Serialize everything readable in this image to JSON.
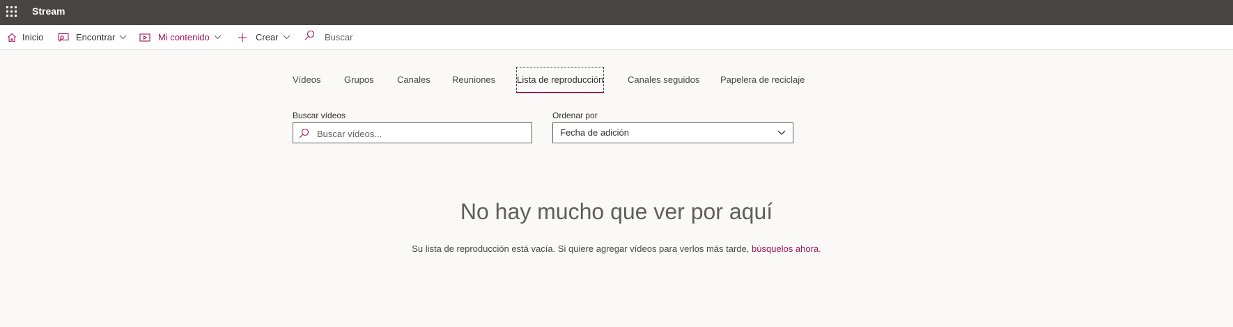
{
  "suite": {
    "app_name": "Stream"
  },
  "nav": {
    "home": "Inicio",
    "discover": "Encontrar",
    "my_content": "Mi contenido",
    "create": "Crear",
    "search": "Buscar"
  },
  "tabs": [
    {
      "label": "Vídeos"
    },
    {
      "label": "Grupos"
    },
    {
      "label": "Canales"
    },
    {
      "label": "Reuniones"
    },
    {
      "label": "Lista de reproducción",
      "selected": true
    },
    {
      "label": "Canales seguidos"
    },
    {
      "label": "Papelera de reciclaje"
    }
  ],
  "filters": {
    "search_label": "Buscar vídeos",
    "search_placeholder": "Buscar vídeos...",
    "sort_label": "Ordenar por",
    "sort_value": "Fecha de adición"
  },
  "empty_state": {
    "title": "No hay mucho que ver por aquí",
    "message": "Su lista de reproducción está vacía. Si quiere agregar vídeos para verlos más tarde,",
    "link": "búsquelos ahora",
    "link_suffix": "."
  },
  "colors": {
    "accent": "#a4135a",
    "suite_bar": "#484644",
    "page_background": "#faf9f8"
  },
  "icons": [
    "waffle-icon",
    "home-icon",
    "discover-icon",
    "my-content-icon",
    "plus-icon",
    "search-icon",
    "chevron-down-icon"
  ]
}
